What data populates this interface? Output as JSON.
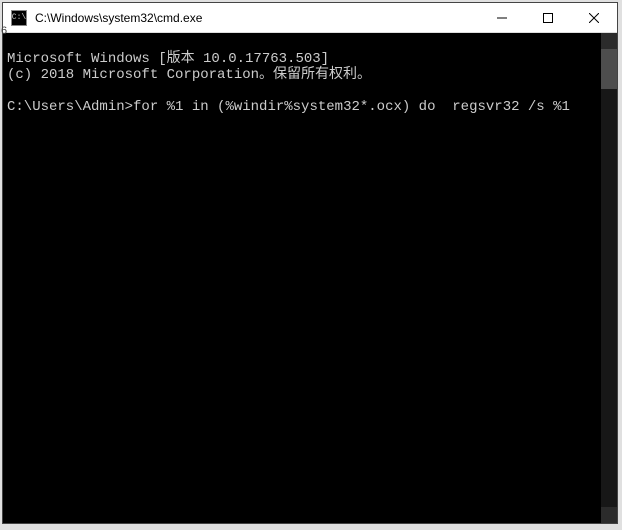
{
  "window": {
    "title": "C:\\Windows\\system32\\cmd.exe",
    "icon_label": "C:\\"
  },
  "terminal": {
    "line1": "Microsoft Windows [版本 10.0.17763.503]",
    "line2": "(c) 2018 Microsoft Corporation。保留所有权利。",
    "blank": "",
    "prompt": "C:\\Users\\Admin>",
    "command": "for %1 in (%windir%system32*.ocx) do  regsvr32 /s %1"
  },
  "footnote": "6"
}
